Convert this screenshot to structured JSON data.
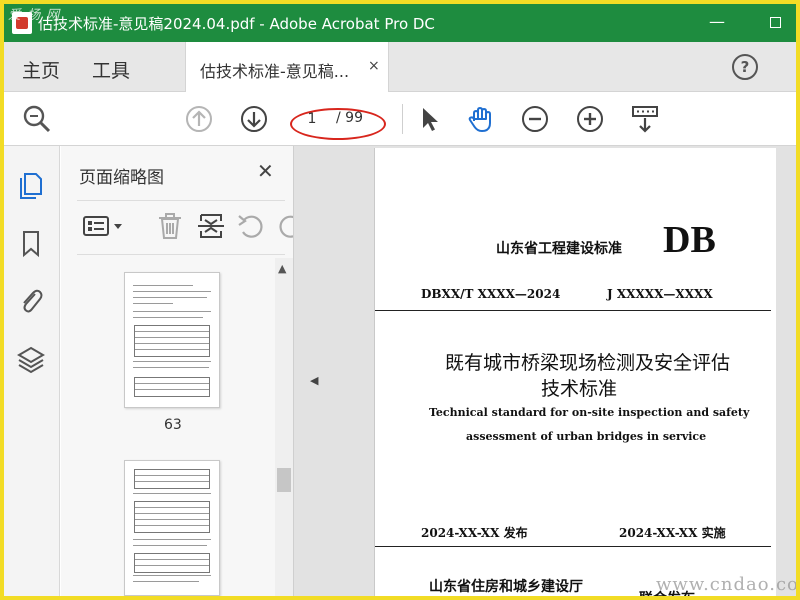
{
  "window": {
    "title": "估技术标准-意见稿2024.04.pdf - Adobe Acrobat Pro DC",
    "watermark_top": "爱 扬 网"
  },
  "tabs": {
    "home": "主页",
    "tools": "工具",
    "doc_tab": "估技术标准-意见稿...",
    "close_glyph": "×",
    "help_glyph": "?"
  },
  "toolbar": {
    "current_page": "1",
    "total_pages": "/ 99"
  },
  "thumbnail_panel": {
    "title": "页面缩略图",
    "close_glyph": "✕",
    "page_label": "63"
  },
  "document": {
    "org": "山东省工程建设标准",
    "db_mark": "DB",
    "std_number": "DBXX/T XXXX—2024",
    "j_number": "J XXXXX—XXXX",
    "title_cn_line1": "既有城市桥梁现场检测及安全评估",
    "title_cn_line2": "技术标准",
    "title_en_line1": "Technical standard for on-site inspection and safety",
    "title_en_line2": "assessment of urban bridges in service",
    "issue_date": "2024-XX-XX 发布",
    "impl_date": "2024-XX-XX 实施",
    "department": "山东省住房和城乡建设厅",
    "joint_release": "联合发布"
  },
  "watermark_bottom": "www.cndao.co",
  "colors": {
    "titlebar": "#1e8c3f",
    "frame_border": "#f2dc25",
    "highlight_oval": "#d8261d",
    "hand_tool": "#1f6fd1"
  }
}
